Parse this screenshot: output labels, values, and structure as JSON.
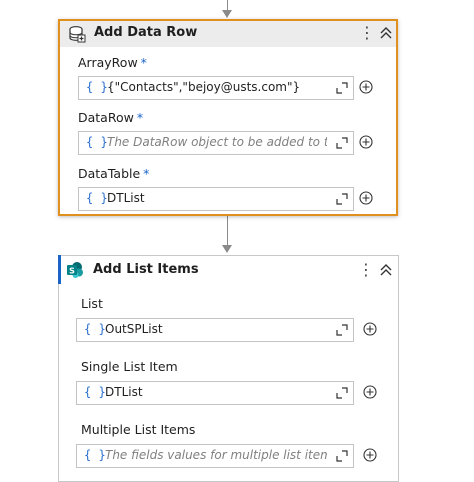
{
  "activities": [
    {
      "title": "Add Data Row",
      "selected": true,
      "fields": [
        {
          "label": "ArrayRow",
          "required": true,
          "value": "{\"Contacts\",\"bejoy@usts.com\"}",
          "placeholder": ""
        },
        {
          "label": "DataRow",
          "required": true,
          "value": "",
          "placeholder": "The DataRow object to be added to the Dc"
        },
        {
          "label": "DataTable",
          "required": true,
          "value": "DTList",
          "placeholder": ""
        }
      ]
    },
    {
      "title": "Add List Items",
      "selected": false,
      "fields": [
        {
          "label": "List",
          "required": false,
          "value": "OutSPList",
          "placeholder": ""
        },
        {
          "label": "Single List Item",
          "required": false,
          "value": "DTList",
          "placeholder": ""
        },
        {
          "label": "Multiple List Items",
          "required": false,
          "value": "",
          "placeholder": "The fields values for multiple list items. The"
        }
      ]
    }
  ],
  "common": {
    "required_marker": "*",
    "braces": "{ }",
    "menu_glyph": "⋮"
  },
  "icons": [
    "database-icon",
    "sharepoint-icon",
    "more-options-icon",
    "collapse-icon",
    "expand-editor-icon",
    "add-icon"
  ],
  "colors": {
    "selection_border": "#e0901f",
    "required_marker": "#1a64c8",
    "braces": "#2b6fcf",
    "sharepoint": "#038387"
  }
}
